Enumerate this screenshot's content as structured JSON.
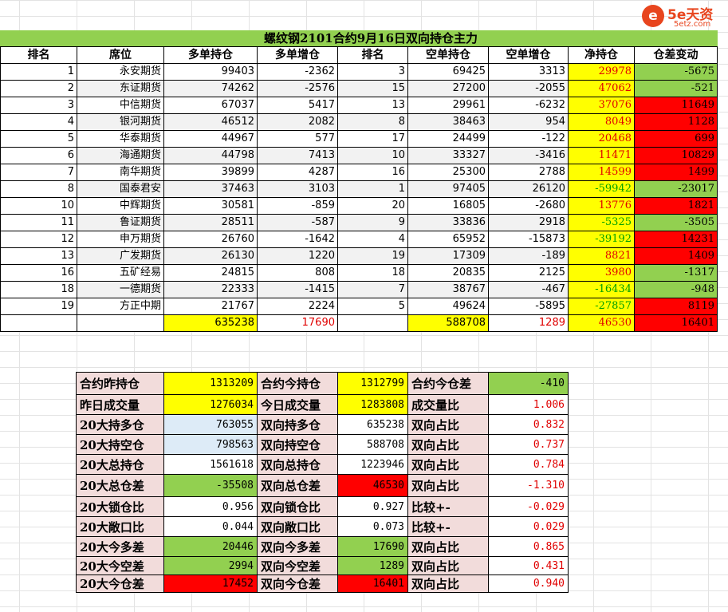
{
  "logo": {
    "mark": "e",
    "name": "5e天资",
    "url": "5etz.com"
  },
  "title": "螺纹钢2101合约9月16日双向持仓主力",
  "headers": [
    "排名",
    "席位",
    "多单持仓",
    "多单增仓",
    "排名",
    "空单持仓",
    "空单增仓",
    "净持仓",
    "仓差变动"
  ],
  "rows": [
    [
      "1",
      "永安期货",
      "99403",
      "-2362",
      "3",
      "69425",
      "3313",
      "29978",
      "-5675"
    ],
    [
      "2",
      "东证期货",
      "74262",
      "-2576",
      "15",
      "27200",
      "-2055",
      "47062",
      "-521"
    ],
    [
      "3",
      "中信期货",
      "67037",
      "5417",
      "13",
      "29961",
      "-6232",
      "37076",
      "11649"
    ],
    [
      "4",
      "银河期货",
      "46512",
      "2082",
      "8",
      "38463",
      "954",
      "8049",
      "1128"
    ],
    [
      "5",
      "华泰期货",
      "44967",
      "577",
      "17",
      "24499",
      "-122",
      "20468",
      "699"
    ],
    [
      "6",
      "海通期货",
      "44798",
      "7413",
      "10",
      "33327",
      "-3416",
      "11471",
      "10829"
    ],
    [
      "7",
      "南华期货",
      "39899",
      "4287",
      "16",
      "25300",
      "2788",
      "14599",
      "1499"
    ],
    [
      "8",
      "国泰君安",
      "37463",
      "3103",
      "1",
      "97405",
      "26120",
      "-59942",
      "-23017"
    ],
    [
      "10",
      "中辉期货",
      "30581",
      "-859",
      "20",
      "16805",
      "-2680",
      "13776",
      "1821"
    ],
    [
      "11",
      "鲁证期货",
      "28511",
      "-587",
      "9",
      "33836",
      "2918",
      "-5325",
      "-3505"
    ],
    [
      "12",
      "申万期货",
      "26760",
      "-1642",
      "4",
      "65952",
      "-15873",
      "-39192",
      "14231"
    ],
    [
      "13",
      "广发期货",
      "26130",
      "1220",
      "19",
      "17309",
      "-189",
      "8821",
      "1409"
    ],
    [
      "16",
      "五矿经易",
      "24815",
      "808",
      "18",
      "20835",
      "2125",
      "3980",
      "-1317"
    ],
    [
      "18",
      "一德期货",
      "22333",
      "-1415",
      "7",
      "38767",
      "-467",
      "-16434",
      "-948"
    ],
    [
      "19",
      "方正中期",
      "21767",
      "2224",
      "5",
      "49624",
      "-5895",
      "-27857",
      "8119"
    ]
  ],
  "totals": [
    "",
    "",
    "635238",
    "17690",
    "",
    "588708",
    "1289",
    "46530",
    "16401"
  ],
  "summary": [
    [
      {
        "label": "合约昨持仓"
      },
      {
        "value": "1313209",
        "bg": "yellow"
      },
      {
        "label": "合约今持仓"
      },
      {
        "value": "1312799",
        "bg": "yellow"
      },
      {
        "label": "合约今仓差"
      },
      {
        "value": "-410",
        "bg": "green"
      }
    ],
    [
      {
        "label": "昨日成交量"
      },
      {
        "value": "1276034",
        "bg": "yellow"
      },
      {
        "label": "今日成交量"
      },
      {
        "value": "1283808",
        "bg": "yellow"
      },
      {
        "label": "成交量比"
      },
      {
        "value": "1.006",
        "bg": "white",
        "red": true
      }
    ],
    [
      {
        "label": "20大持多仓"
      },
      {
        "value": "763055",
        "bg": "blue"
      },
      {
        "label": "双向持多仓"
      },
      {
        "value": "635238",
        "bg": "white"
      },
      {
        "label": "双向占比"
      },
      {
        "value": "0.832",
        "bg": "white",
        "red": true
      }
    ],
    [
      {
        "label": "20大持空仓"
      },
      {
        "value": "798563",
        "bg": "blue"
      },
      {
        "label": "双向持空仓"
      },
      {
        "value": "588708",
        "bg": "white"
      },
      {
        "label": "双向占比"
      },
      {
        "value": "0.737",
        "bg": "white",
        "red": true
      }
    ],
    [
      {
        "label": "20大总持仓"
      },
      {
        "value": "1561618",
        "bg": "white"
      },
      {
        "label": "双向总持仓"
      },
      {
        "value": "1223946",
        "bg": "white"
      },
      {
        "label": "双向占比"
      },
      {
        "value": "0.784",
        "bg": "white",
        "red": true
      }
    ],
    [
      {
        "label": "20大总仓差"
      },
      {
        "value": "-35508",
        "bg": "green"
      },
      {
        "label": "双向总仓差"
      },
      {
        "value": "46530",
        "bg": "red"
      },
      {
        "label": "双向占比"
      },
      {
        "value": "-1.310",
        "bg": "white",
        "red": true
      }
    ],
    [
      {
        "label": "20大锁仓比"
      },
      {
        "value": "0.956",
        "bg": "white"
      },
      {
        "label": "双向锁仓比"
      },
      {
        "value": "0.927",
        "bg": "white"
      },
      {
        "label": "比较+-"
      },
      {
        "value": "-0.029",
        "bg": "white",
        "red": true
      }
    ],
    [
      {
        "label": "20大敞口比"
      },
      {
        "value": "0.044",
        "bg": "white"
      },
      {
        "label": "双向敞口比"
      },
      {
        "value": "0.073",
        "bg": "white"
      },
      {
        "label": "比较+-"
      },
      {
        "value": "0.029",
        "bg": "white",
        "red": true
      }
    ],
    [
      {
        "label": "20大今多差"
      },
      {
        "value": "20446",
        "bg": "green"
      },
      {
        "label": "双向今多差"
      },
      {
        "value": "17690",
        "bg": "green"
      },
      {
        "label": "双向占比"
      },
      {
        "value": "0.865",
        "bg": "white",
        "red": true
      }
    ],
    [
      {
        "label": "20大今空差"
      },
      {
        "value": "2994",
        "bg": "green"
      },
      {
        "label": "双向今空差"
      },
      {
        "value": "1289",
        "bg": "green"
      },
      {
        "label": "双向占比"
      },
      {
        "value": "0.431",
        "bg": "white",
        "red": true
      }
    ],
    [
      {
        "label": "20大今仓差"
      },
      {
        "value": "17452",
        "bg": "red"
      },
      {
        "label": "双向今仓差"
      },
      {
        "value": "16401",
        "bg": "red"
      },
      {
        "label": "双向占比"
      },
      {
        "value": "0.940",
        "bg": "white",
        "red": true
      }
    ]
  ]
}
